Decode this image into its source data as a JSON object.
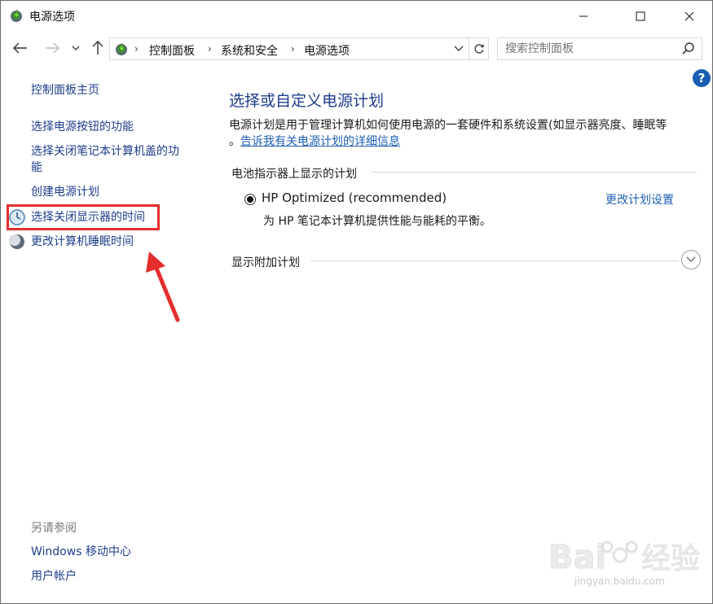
{
  "window": {
    "title": "电源选项"
  },
  "address": {
    "crumbs": [
      "控制面板",
      "系统和安全",
      "电源选项"
    ],
    "search_placeholder": "搜索控制面板"
  },
  "sidebar": {
    "home": "控制面板主页",
    "links": [
      "选择电源按钮的功能",
      "选择关闭笔记本计算机盖的功",
      "能",
      "创建电源计划",
      "选择关闭显示器的时间",
      "更改计算机睡眠时间"
    ],
    "see_also_heading": "另请参阅",
    "see_also": [
      "Windows 移动中心",
      "用户帐户"
    ]
  },
  "main": {
    "title": "选择或自定义电源计划",
    "description": "电源计划是用于管理计算机如何使用电源的一套硬件和系统设置(如显示器亮度、睡眠等",
    "desc_prefix": "。",
    "more_info_link": "告诉我有关电源计划的详细信息",
    "battery_section": "电池指示器上显示的计划",
    "plan": {
      "name": "HP Optimized (recommended)",
      "description": "为 HP 笔记本计算机提供性能与能耗的平衡。",
      "settings_link": "更改计划设置",
      "selected": true
    },
    "additional_section": "显示附加计划"
  },
  "watermark": {
    "text": "jingyan.baidu.com"
  },
  "colors": {
    "link": "#1e3d8c",
    "accent": "#1e5fb4",
    "highlight": "#e52e2e"
  }
}
